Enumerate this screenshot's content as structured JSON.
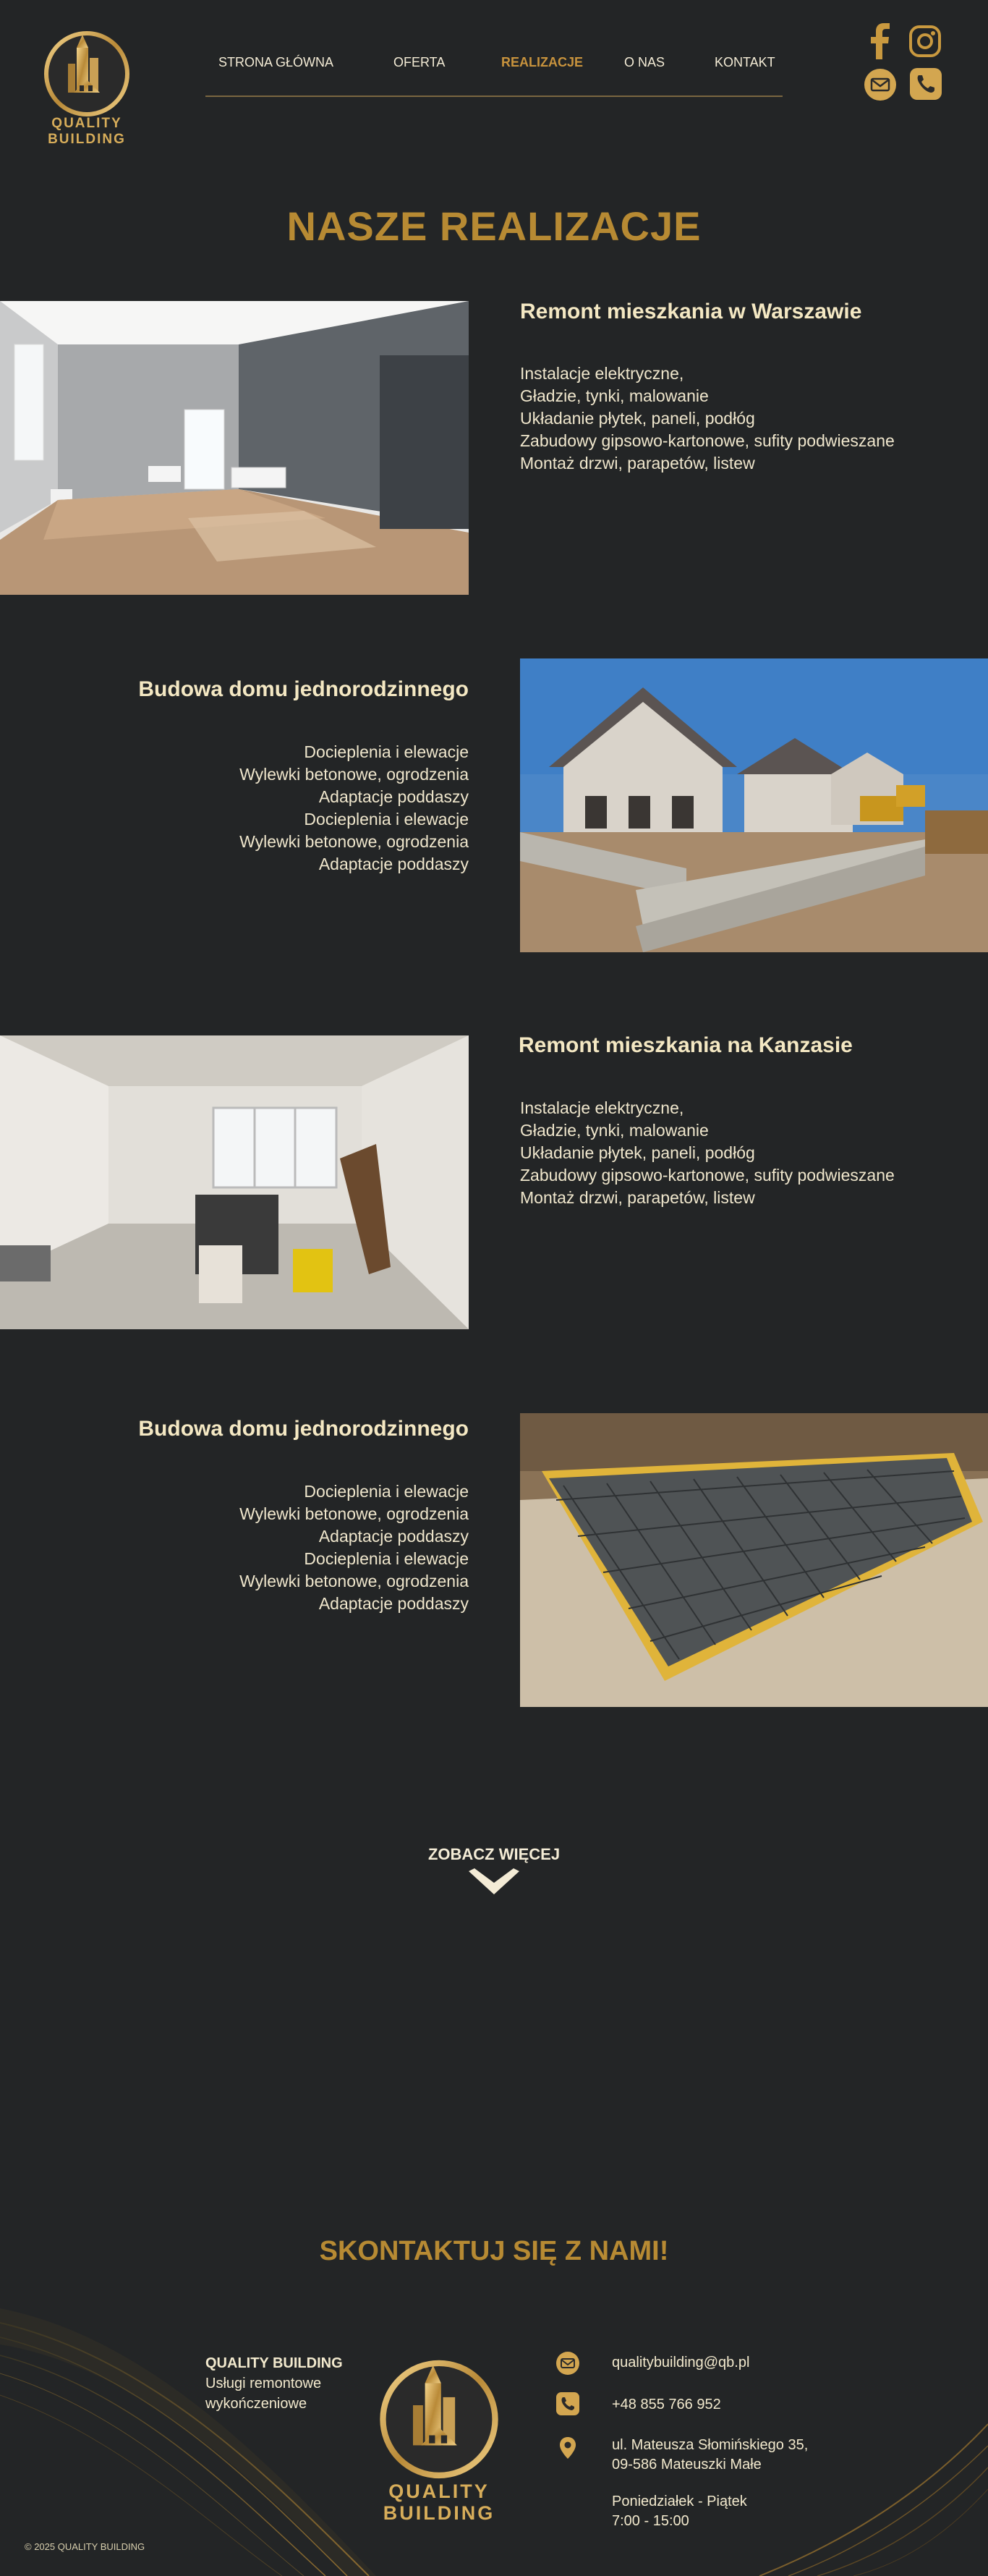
{
  "brand": {
    "line1": "QUALITY",
    "line2": "BUILDING"
  },
  "nav": [
    {
      "label": "STRONA GŁÓWNA"
    },
    {
      "label": "OFERTA"
    },
    {
      "label": "REALIZACJE",
      "active": true
    },
    {
      "label": "O NAS"
    },
    {
      "label": "KONTAKT"
    }
  ],
  "social": [
    "facebook-icon",
    "instagram-icon",
    "mail-icon",
    "phone-icon"
  ],
  "page_title": "NASZE REALIZACJE",
  "projects": [
    {
      "title": "Remont mieszkania w Warszawie",
      "items": [
        "Instalacje elektryczne,",
        "Gładzie, tynki, malowanie",
        "Układanie płytek, paneli, podłóg",
        "Zabudowy gipsowo-kartonowe, sufity podwieszane",
        "Montaż drzwi, parapetów, listew"
      ]
    },
    {
      "title": "Budowa domu jednorodzinnego",
      "items": [
        "Docieplenia i elewacje",
        "Wylewki betonowe, ogrodzenia",
        "Adaptacje poddaszy",
        "Docieplenia i elewacje",
        "Wylewki betonowe, ogrodzenia",
        "Adaptacje poddaszy"
      ]
    },
    {
      "title": "Remont mieszkania na Kanzasie",
      "items": [
        "Instalacje elektryczne,",
        "Gładzie, tynki, malowanie",
        "Układanie płytek, paneli, podłóg",
        "Zabudowy gipsowo-kartonowe, sufity podwieszane",
        "Montaż drzwi, parapetów, listew"
      ]
    },
    {
      "title": "Budowa domu jednorodzinnego",
      "items": [
        "Docieplenia i elewacje",
        "Wylewki betonowe, ogrodzenia",
        "Adaptacje poddaszy",
        "Docieplenia i elewacje",
        "Wylewki betonowe, ogrodzenia",
        "Adaptacje poddaszy"
      ]
    }
  ],
  "see_more": "ZOBACZ WIĘCEJ",
  "contact": {
    "title": "SKONTAKTUJ SIĘ Z NAMI!",
    "company_name": "QUALITY BUILDING",
    "company_desc_1": "Usługi remontowe",
    "company_desc_2": "wykończeniowe",
    "email": "qualitybuilding@qb.pl",
    "phone": "+48 855 766 952",
    "address_1": "ul. Mateusza Słomińskiego 35,",
    "address_2": "09-586 Mateuszki Małe",
    "hours_1": "Poniedziałek - Piątek",
    "hours_2": "7:00 - 15:00"
  },
  "copyright": "© 2025 QUALITY BUILDING",
  "colors": {
    "background": "#232526",
    "accent": "#b78a33",
    "text": "#f1e7c7"
  }
}
